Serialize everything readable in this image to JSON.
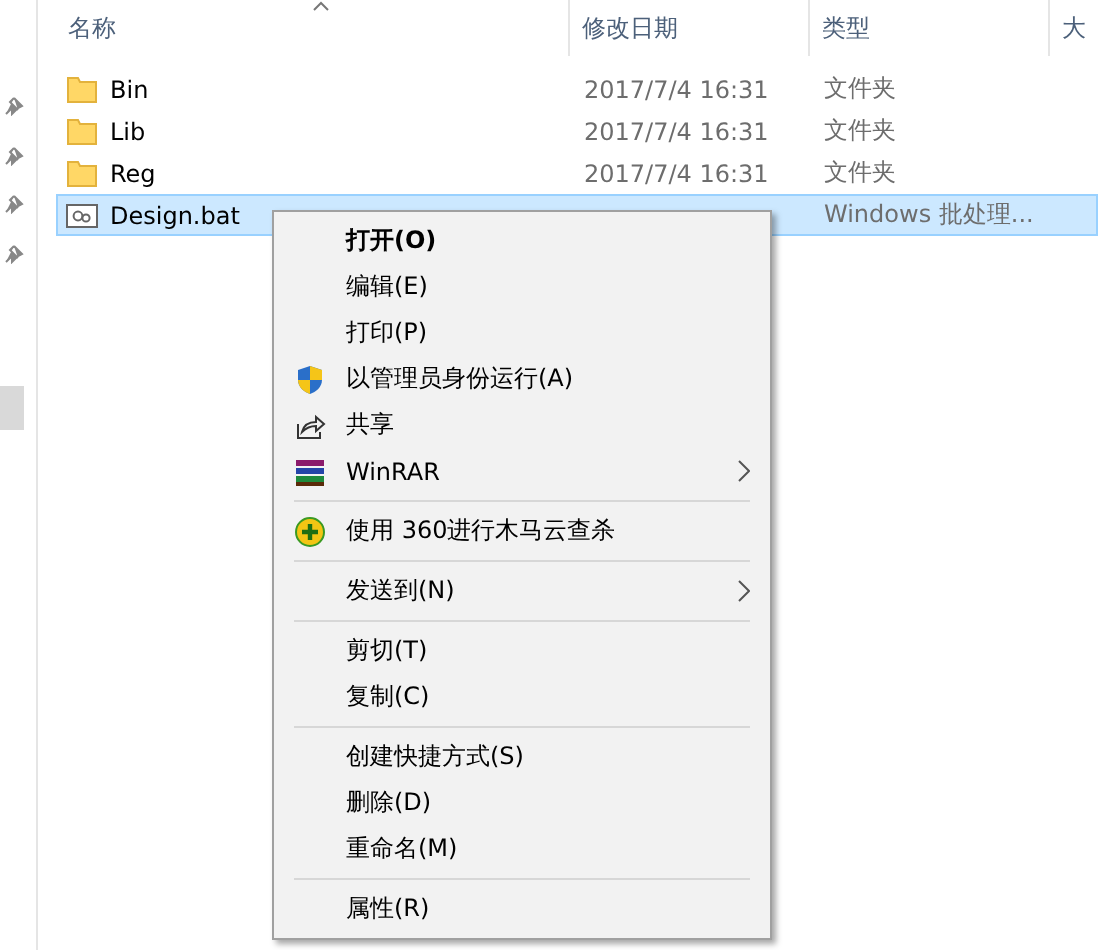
{
  "columns": [
    {
      "label": "名称",
      "sorted": true
    },
    {
      "label": "修改日期",
      "sorted": false
    },
    {
      "label": "类型",
      "sorted": false
    },
    {
      "label": "大",
      "sorted": false
    }
  ],
  "files": [
    {
      "name": "Bin",
      "date": "2017/7/4 16:31",
      "type": "文件夹",
      "kind": "folder",
      "selected": false
    },
    {
      "name": "Lib",
      "date": "2017/7/4 16:31",
      "type": "文件夹",
      "kind": "folder",
      "selected": false
    },
    {
      "name": "Reg",
      "date": "2017/7/4 16:31",
      "type": "文件夹",
      "kind": "folder",
      "selected": false
    },
    {
      "name": "Design.bat",
      "type": "Windows 批处理...",
      "kind": "batch",
      "selected": true
    }
  ],
  "context_menu": {
    "groups": [
      [
        {
          "label": "打开(O)",
          "default": true,
          "submenu": false
        },
        {
          "label": "编辑(E)",
          "default": false,
          "submenu": false
        },
        {
          "label": "打印(P)",
          "default": false,
          "submenu": false
        },
        {
          "label": "以管理员身份运行(A)",
          "kind": "shield",
          "default": false,
          "submenu": false
        },
        {
          "label": "共享",
          "kind": "share",
          "default": false,
          "submenu": false
        },
        {
          "label": "WinRAR",
          "kind": "books",
          "default": false,
          "submenu": true
        }
      ],
      [
        {
          "label": "使用 360进行木马云查杀",
          "kind": "plus",
          "default": false,
          "submenu": false
        }
      ],
      [
        {
          "label": "发送到(N)",
          "default": false,
          "submenu": true
        }
      ],
      [
        {
          "label": "剪切(T)",
          "default": false,
          "submenu": false
        },
        {
          "label": "复制(C)",
          "default": false,
          "submenu": false
        }
      ],
      [
        {
          "label": "创建快捷方式(S)",
          "default": false,
          "submenu": false
        },
        {
          "label": "删除(D)",
          "default": false,
          "submenu": false
        },
        {
          "label": "重命名(M)",
          "default": false,
          "submenu": false
        }
      ],
      [
        {
          "label": "属性(R)",
          "default": false,
          "submenu": false
        }
      ]
    ]
  }
}
